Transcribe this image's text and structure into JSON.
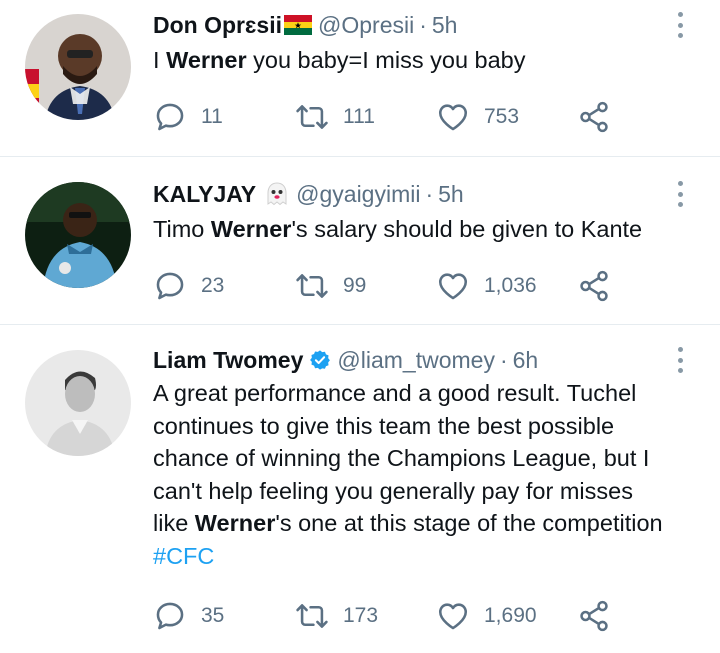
{
  "tweets": [
    {
      "name": "Don Oprɛsii",
      "handle": "@Opresii",
      "separator": "·",
      "time": "5h",
      "flag_icon": "ghana-flag-icon",
      "text_parts": [
        "I ",
        "Werner",
        " you baby=I miss you baby"
      ],
      "replies": "11",
      "retweets": "111",
      "likes": "753"
    },
    {
      "name": "KALYJAY",
      "handle": "@gyaigyimii",
      "separator": "·",
      "time": "5h",
      "emoji_icon": "ghost-emoji-icon",
      "text_parts": [
        "Timo ",
        "Werner",
        "'s salary should be given to Kante"
      ],
      "replies": "23",
      "retweets": "99",
      "likes": "1,036"
    },
    {
      "name": "Liam Twomey",
      "handle": "@liam_twomey",
      "separator": "·",
      "time": "6h",
      "verified_icon": "verified-badge-icon",
      "text_lines": [
        "A great performance and a good result. Tuchel",
        "continues to give this team the best possible",
        "chance of winning the Champions League, but I",
        "can't help feeling you generally pay for misses"
      ],
      "text_last_prefix": "like ",
      "text_last_bold": "Werner",
      "text_last_suffix": "'s one at this stage of the competition",
      "hashtag": "#CFC",
      "replies": "35",
      "retweets": "173",
      "likes": "1,690"
    }
  ],
  "colors": {
    "text": "#0f1419",
    "secondary": "#5b7083",
    "link": "#1da1f2",
    "divider": "#e6ecf0",
    "verified": "#1da1f2"
  }
}
